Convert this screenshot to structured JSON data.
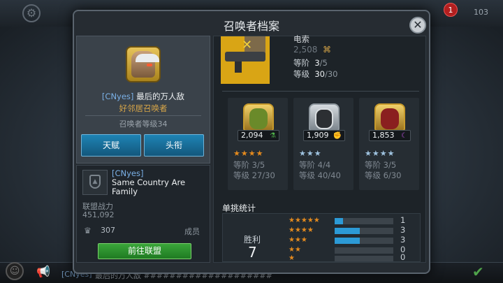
{
  "background": {
    "notification_count": "1",
    "top_count": "103",
    "chat_tag": "[CNyes]",
    "chat_text": "最后的万人敌 ####################"
  },
  "modal": {
    "title": "召唤者档案",
    "close_icon": "close-icon"
  },
  "profile": {
    "alliance_tag": "[CNyes]",
    "summoner_name": "最后的万人敌",
    "summoner_title": "好邻居召唤者",
    "summoner_level": "召唤者等级34",
    "buttons": {
      "talents": "天赋",
      "titles": "头衔"
    }
  },
  "alliance": {
    "tag": "[CNyes]",
    "name": "Same Country Are Family",
    "power_label": "联盟战力",
    "power_value": "451,092",
    "member_count": "307",
    "member_label": "成员",
    "go_button": "前往联盟"
  },
  "featured_hero": {
    "name": "电索",
    "pi": "2,508",
    "rank_label": "等阶",
    "rank_value": "3",
    "rank_max": "/5",
    "level_label": "等级",
    "level_value": "30",
    "level_max": "/30"
  },
  "champions": [
    {
      "pi": "2,094",
      "stars": "★★★★",
      "star_color": "#e48a1e",
      "class_color": "#4fb34a",
      "rank_label": "等阶",
      "rank": "3/5",
      "level_label": "等级",
      "level": "27/30"
    },
    {
      "pi": "1,909",
      "stars": "★★★",
      "star_color": "#9fc3e0",
      "class_color": "#d63a2a",
      "rank_label": "等阶",
      "rank": "4/4",
      "level_label": "等级",
      "level": "40/40"
    },
    {
      "pi": "1,853",
      "stars": "★★★★",
      "star_color": "#9fc3e0",
      "class_color": "#b34fd6",
      "rank_label": "等阶",
      "rank": "3/5",
      "level_label": "等级",
      "level": "6/30"
    }
  ],
  "duel_stats": {
    "title": "单挑统计",
    "wins_label": "胜利",
    "wins_value": "7",
    "rows": [
      {
        "stars": "★★★★★",
        "count": "1",
        "fill": 0.14
      },
      {
        "stars": "★★★★",
        "count": "3",
        "fill": 0.43
      },
      {
        "stars": "★★★",
        "count": "3",
        "fill": 0.43
      },
      {
        "stars": "★★",
        "count": "0",
        "fill": 0
      },
      {
        "stars": "★",
        "count": "0",
        "fill": 0
      }
    ]
  }
}
